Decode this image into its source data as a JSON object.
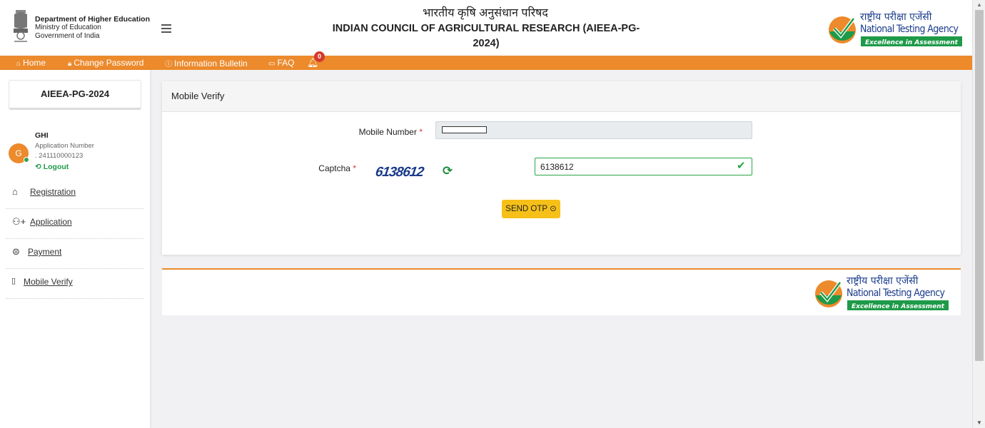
{
  "header": {
    "dept_line1": "Department of Higher Education",
    "dept_line2": "Ministry of Education",
    "dept_line3": "Government of India",
    "title_hindi": "भारतीय कृषि अनुसंधान परिषद",
    "title_english": "INDIAN COUNCIL OF AGRICULTURAL RESEARCH (AIEEA-PG-2024)",
    "logo_hindi": "राष्ट्रीय परीक्षा एजेंसी",
    "logo_english": "National Testing Agency",
    "logo_tagline": "Excellence in Assessment"
  },
  "nav": {
    "home": "Home",
    "change_password": "Change Password",
    "info_bulletin": "Information Bulletin",
    "faq": "FAQ",
    "notification_count": "0"
  },
  "sidebar": {
    "exam": "AIEEA-PG-2024",
    "avatar_initial": "G",
    "user_name": "GHI",
    "app_number_label": "Application Number",
    "app_number": ". 241110000123",
    "logout": "Logout",
    "items": [
      {
        "label": "Registration",
        "icon": "home-icon"
      },
      {
        "label": "Application",
        "icon": "user-plus-icon"
      },
      {
        "label": "Payment",
        "icon": "payment-icon"
      },
      {
        "label": "Mobile Verify",
        "icon": "mobile-icon"
      }
    ]
  },
  "form": {
    "title": "Mobile Verify",
    "mobile_label": "Mobile Number",
    "captcha_label": "Captcha",
    "captcha_text": "6138612",
    "captcha_value": "6138612",
    "send_otp": "SEND OTP"
  },
  "footer": {
    "logo_hindi": "राष्ट्रीय परीक्षा एजेंसी",
    "logo_english": "National Testing Agency",
    "logo_tagline": "Excellence in Assessment"
  },
  "colors": {
    "nav_orange": "#ec8a2c",
    "logout_green": "#1e9a48",
    "button_yellow": "#f6c018",
    "nta_green": "#1e9a48"
  }
}
